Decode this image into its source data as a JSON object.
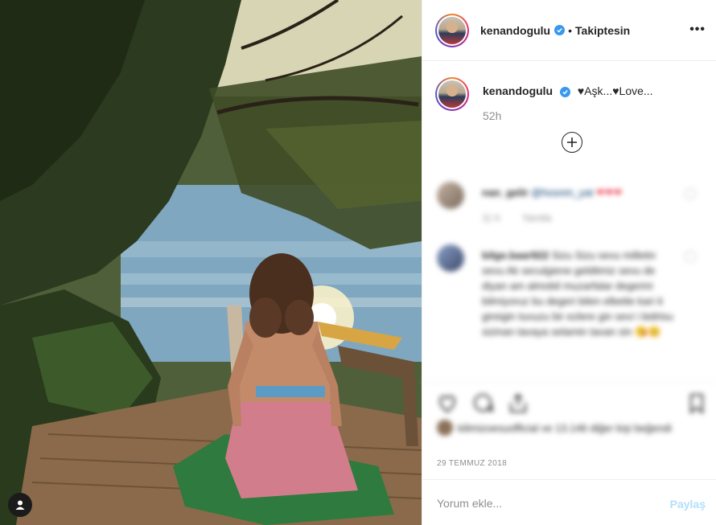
{
  "post": {
    "username": "kenandogulu",
    "follow_status": "Takiptesin",
    "header_separator": "•",
    "caption": "♥Aşk...♥Love...",
    "time_ago": "52h",
    "date": "29 TEMMUZ 2018"
  },
  "comments": [
    {
      "username": "nan_gelir",
      "mention": "@hosnm_yat",
      "text": "❤❤❤",
      "time": "11 h",
      "reply_label": "Yanıtla"
    },
    {
      "username": "bilge.baar922",
      "text": "Sizu Sizu sevu milletin sevu Ak seculgiene gelditmiz sevu de diyan am almobil muzarfalar degerini bilmiyoruz bu degeri bilen elbette kari it gireigin tuvuzu bir ezlere gin sevi i bidrtsu sizinan tavaya selamin tavan sin 😘😊"
    }
  ],
  "likes": {
    "text": "kilimizoesuofficial ve 13.146 diğer kişi beğendi"
  },
  "comment_input": {
    "placeholder": "Yorum ekle...",
    "submit_label": "Paylaş"
  },
  "icons": {
    "more": "more-horizontal-icon",
    "verified": "verified-badge-icon",
    "load_more": "plus-circle-icon",
    "like": "heart-icon",
    "comment": "comment-icon",
    "share": "share-icon",
    "save": "bookmark-icon",
    "user_tag": "user-tag-icon"
  },
  "colors": {
    "verified_blue": "#3897f0",
    "muted_text": "#8e8e8e",
    "post_button_disabled": "#b2dffc",
    "hearts_red": "#ed4956"
  }
}
